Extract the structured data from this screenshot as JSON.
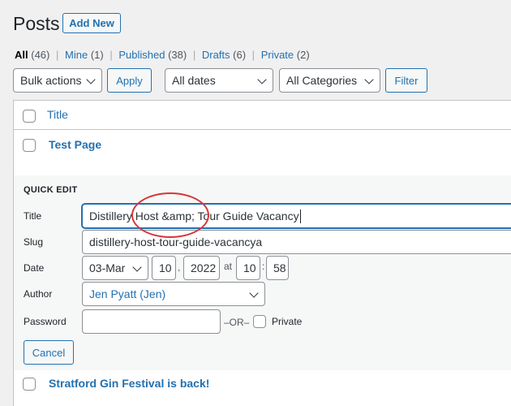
{
  "header": {
    "title": "Posts",
    "add_new": "Add New"
  },
  "views": {
    "all": {
      "label": "All",
      "count": "(46)"
    },
    "mine": {
      "label": "Mine",
      "count": "(1)"
    },
    "published": {
      "label": "Published",
      "count": "(38)"
    },
    "drafts": {
      "label": "Drafts",
      "count": "(6)"
    },
    "private": {
      "label": "Private",
      "count": "(2)"
    },
    "separator": "|"
  },
  "filters": {
    "bulk_actions": "Bulk actions",
    "apply": "Apply",
    "dates": "All dates",
    "categories": "All Categories",
    "filter": "Filter"
  },
  "table": {
    "column_title": "Title",
    "rows": [
      {
        "title": "Test Page"
      },
      {
        "title": "Stratford Gin Festival is back!"
      }
    ]
  },
  "quick_edit": {
    "heading": "Quick Edit",
    "title_label": "Title",
    "title_value": "Distillery Host &amp; Tour Guide Vacancy",
    "slug_label": "Slug",
    "slug_value": "distillery-host-tour-guide-vacancya",
    "date_label": "Date",
    "month": "03-Mar",
    "day": "10",
    "comma": ",",
    "year": "2022",
    "at": "at",
    "hour": "10",
    "colon": ":",
    "minute": "58",
    "author_label": "Author",
    "author_value": "Jen Pyatt (Jen)",
    "password_label": "Password",
    "password_value": "",
    "or_text": "–OR–",
    "private_label": "Private",
    "cancel": "Cancel"
  },
  "colors": {
    "accent": "#2271b1",
    "annotation": "#d63638"
  }
}
